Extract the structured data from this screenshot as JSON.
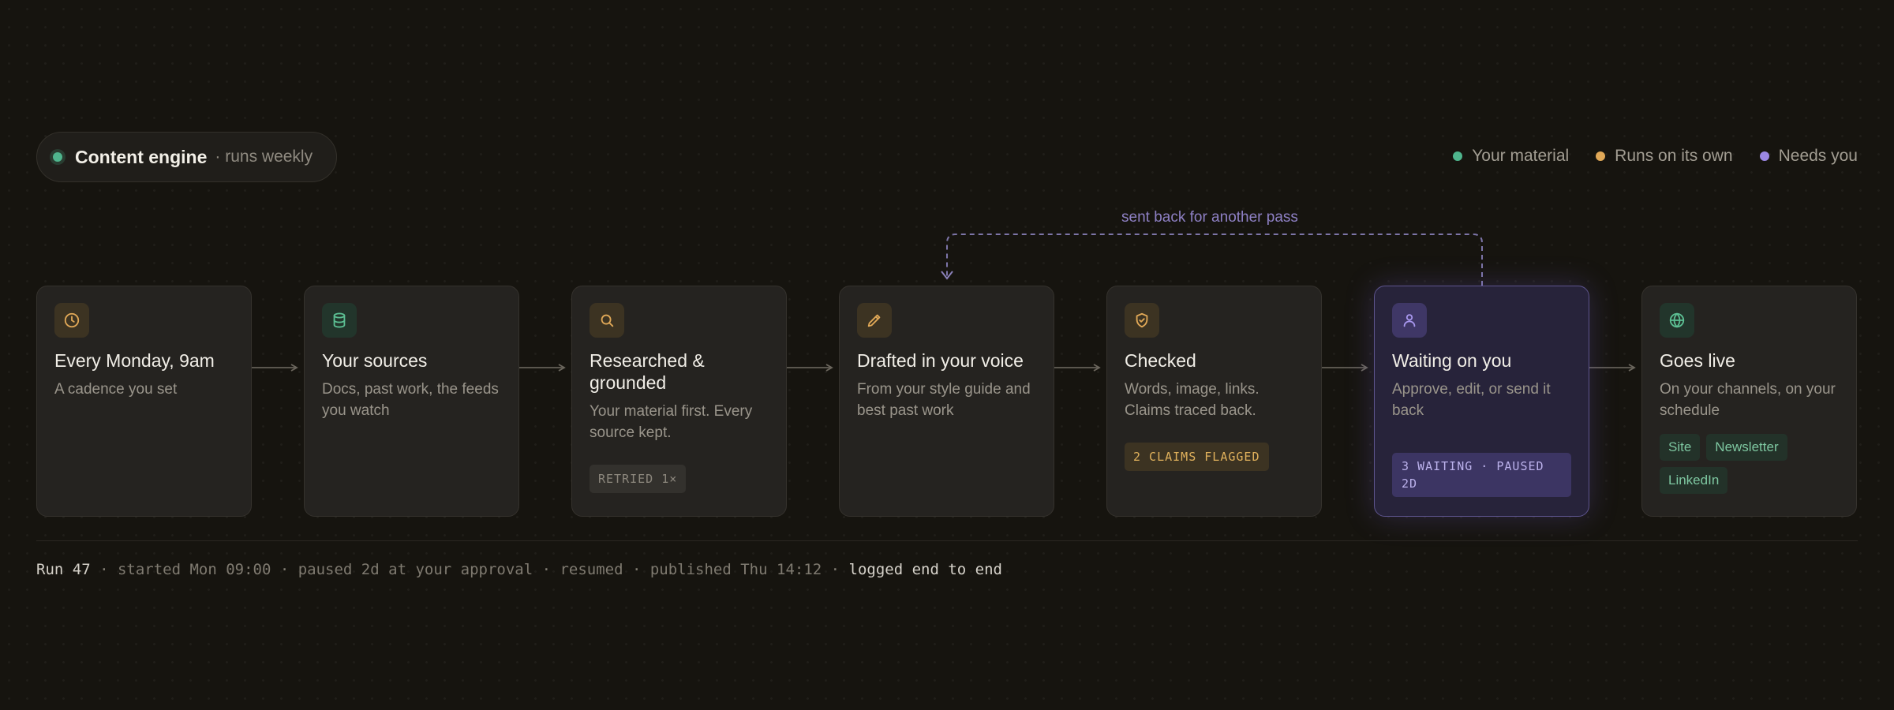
{
  "header": {
    "title": "Content engine",
    "subtitle": "· runs weekly"
  },
  "legend": [
    {
      "label": "Your material",
      "color": "#4fb58d"
    },
    {
      "label": "Runs on its own",
      "color": "#e0a857"
    },
    {
      "label": "Needs you",
      "color": "#9b87e3"
    }
  ],
  "loop_label": "sent back for another pass",
  "steps": [
    {
      "title": "Every Monday, 9am",
      "desc": "A cadence you set",
      "icon": "clock-icon",
      "kind": "auto"
    },
    {
      "title": "Your sources",
      "desc": "Docs, past work, the feeds you watch",
      "icon": "database-icon",
      "kind": "material"
    },
    {
      "title": "Researched & grounded",
      "desc": "Your material first. Every source kept.",
      "icon": "search-icon",
      "kind": "auto",
      "badge": "RETRIED 1×"
    },
    {
      "title": "Drafted in your voice",
      "desc": "From your style guide and best past work",
      "icon": "pencil-icon",
      "kind": "auto"
    },
    {
      "title": "Checked",
      "desc": "Words, image, links. Claims traced back.",
      "icon": "shield-check-icon",
      "kind": "auto",
      "badge": "2 CLAIMS FLAGGED"
    },
    {
      "title": "Waiting on you",
      "desc": "Approve, edit, or send it back",
      "icon": "user-icon",
      "kind": "you",
      "badge": "3 WAITING · PAUSED 2D"
    },
    {
      "title": "Goes live",
      "desc": "On your channels, on your schedule",
      "icon": "globe-icon",
      "kind": "material",
      "chips": [
        "Site",
        "Newsletter",
        "LinkedIn"
      ]
    }
  ],
  "status": {
    "lead": "Run 47",
    "middle": " · started Mon 09:00 · paused 2d at your approval · resumed · published Thu 14:12 · ",
    "tail": "logged end to end"
  }
}
